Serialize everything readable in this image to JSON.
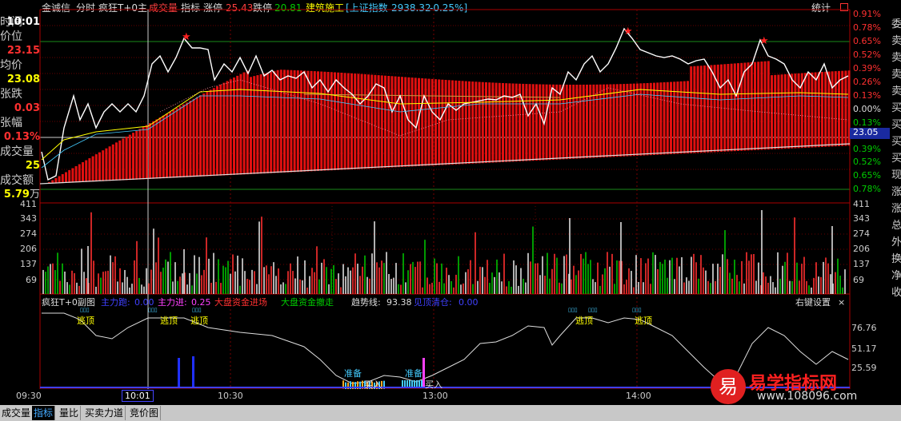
{
  "topbar": {
    "name": "金诚信",
    "view": "分时",
    "formula": "疯狂T+0主",
    "volume_btn": "成交量",
    "indicator_btn": "指标",
    "limit_up_label": "涨停",
    "limit_up_value": "25.43",
    "limit_down_label": "跌停",
    "limit_down_value": "20.81",
    "sector": "建筑施工",
    "index_name": "[上证指数",
    "index_value": "2938.32",
    "index_change": "-0.25%]",
    "stats_btn": "统计"
  },
  "left_panel": {
    "time_label": "时间",
    "time_value": "10:01",
    "price_label": "价位",
    "price_value": "23.15",
    "avg_label": "均价",
    "avg_value": "23.08",
    "change_label": "张跌",
    "change_value": "0.03",
    "pct_label": "张幅",
    "pct_value": "0.13%",
    "vol_label": "成交量",
    "vol_value": "25",
    "amount_label": "成交额",
    "amount_value": "5.79",
    "amount_unit": "万"
  },
  "right_scale_price": [
    "0.91%",
    "0.78%",
    "0.65%",
    "0.52%",
    "0.39%",
    "0.26%",
    "0.13%",
    "0.00%",
    "0.13%",
    "23.05",
    "0.39%",
    "0.52%",
    "0.65%",
    "0.78%"
  ],
  "right_scale_volume": [
    "411",
    "343",
    "274",
    "206",
    "137",
    "69"
  ],
  "right_scale_indicator": [
    "76.76",
    "51.17",
    "25.59"
  ],
  "far_right_chars": [
    "委",
    "卖",
    "卖",
    "卖",
    "卖",
    "买",
    "买",
    "买",
    "买",
    "现",
    "涨",
    "涨",
    "总",
    "外",
    "换",
    "净",
    "收"
  ],
  "sub_header": {
    "title": "疯狂T+0副图",
    "main_out_label": "主力跑:",
    "main_out_value": "0.00",
    "main_in_label": "主力进:",
    "main_in_value": "0.25",
    "big_in_label": "大盘资金进场",
    "big_out_label": "大盘资金撤走",
    "trend_label": "趋势线:",
    "trend_value": "93.38",
    "clear_label": "见顶清仓:",
    "clear_value": "0.00",
    "settings": "右键设置",
    "close": "×"
  },
  "annotations": {
    "escape1": "逃顶",
    "escape2": "逃顶",
    "escape3": "逃顶",
    "escape4": "逃顶",
    "escape5": "逃顶",
    "prepare1": "准备",
    "prepare2": "准备",
    "buy1": "买入",
    "buy2": "买入"
  },
  "time_axis": [
    "09:30",
    "10:01",
    "10:30",
    "13:00",
    "14:00"
  ],
  "tabs": [
    "成交量",
    "指标",
    "量比",
    "买卖力道",
    "竞价图"
  ],
  "watermark": {
    "logo_char": "易",
    "title": "易学指标网",
    "url": "www.108096.com"
  },
  "colors": {
    "up": "#ff3030",
    "down": "#00cc00",
    "price_line": "#ffffff",
    "avg_line": "#ffff00",
    "bar_red": "#e01010",
    "yellow": "#ffff00"
  },
  "chart_data": {
    "type": "line",
    "title": "",
    "price_series": [
      23.05,
      22.95,
      23.0,
      23.08,
      23.1,
      23.12,
      23.13,
      23.15,
      23.2,
      23.22,
      23.24,
      23.22,
      23.2,
      23.18,
      23.16,
      23.15,
      23.14,
      23.12,
      23.14,
      23.16,
      23.15,
      23.1,
      23.12,
      23.14,
      23.15,
      23.14,
      23.16,
      23.16,
      23.15,
      23.14,
      23.13,
      23.14,
      23.16,
      23.2,
      23.25,
      23.26,
      23.2,
      23.18,
      23.2,
      23.22,
      23.2,
      23.14,
      23.17,
      23.15
    ],
    "avg_series": [
      23.05,
      23.03,
      23.05,
      23.07,
      23.08,
      23.09,
      23.1,
      23.11,
      23.12,
      23.13,
      23.14,
      23.14,
      23.14,
      23.14,
      23.14,
      23.14,
      23.14,
      23.14,
      23.14,
      23.14,
      23.14,
      23.14,
      23.14,
      23.14,
      23.14,
      23.14,
      23.14,
      23.14,
      23.14,
      23.14,
      23.14,
      23.14,
      23.15,
      23.15,
      23.16,
      23.16,
      23.16,
      23.16,
      23.16,
      23.16,
      23.16,
      23.16,
      23.16,
      23.16
    ],
    "prev_close": 23.05
  }
}
